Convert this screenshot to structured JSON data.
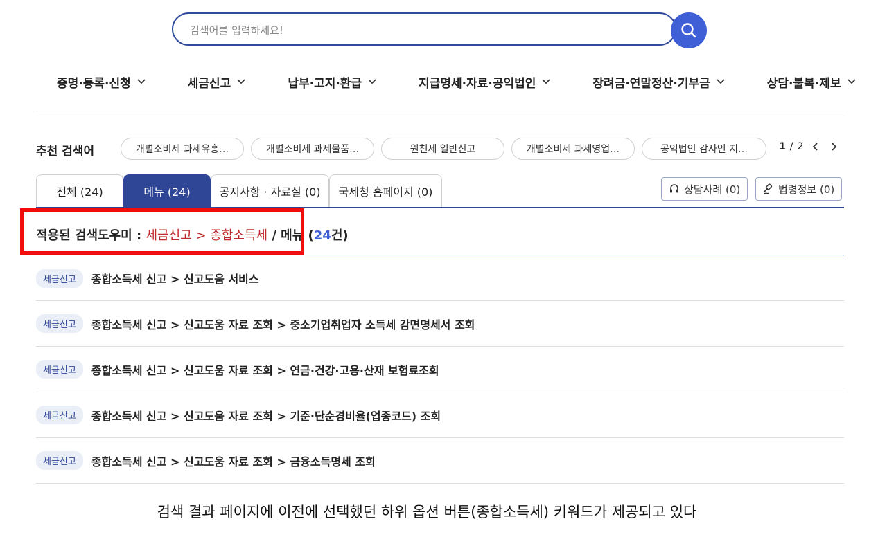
{
  "search": {
    "placeholder": "검색어를 입력하세요!"
  },
  "gnb": [
    {
      "label": "증명·등록·신청"
    },
    {
      "label": "세금신고"
    },
    {
      "label": "납부·고지·환급"
    },
    {
      "label": "지급명세·자료·공익법인"
    },
    {
      "label": "장려금·연말정산·기부금"
    },
    {
      "label": "상담·불복·제보"
    }
  ],
  "recommend": {
    "title": "추천 검색어",
    "chips": [
      {
        "label": "개별소비세 과세유흥…"
      },
      {
        "label": "개별소비세 과세물품…"
      },
      {
        "label": "원천세 일반신고"
      },
      {
        "label": "개별소비세 과세영업…"
      },
      {
        "label": "공익법인 감사인 지…"
      }
    ],
    "page_current": "1",
    "page_sep": "/",
    "page_total": "2"
  },
  "tabs": [
    {
      "label": "전체 (24)"
    },
    {
      "label": "메뉴 (24)"
    },
    {
      "label": "공지사항 · 자료실 (0)"
    },
    {
      "label": "국세청 홈페이지 (0)"
    }
  ],
  "side_buttons": {
    "consult": "상담사례 (0)",
    "law": "법령정보 (0)"
  },
  "applied": {
    "prefix": "적용된 검색도우미 : ",
    "path": "세금신고 > 종합소득세",
    "sep": " / ",
    "category": "메뉴 (",
    "count": "24",
    "suffix": "건)"
  },
  "results": [
    {
      "tag": "세금신고",
      "path": "종합소득세 신고 > 신고도움 서비스"
    },
    {
      "tag": "세금신고",
      "path": "종합소득세 신고 > 신고도움 자료 조회 > 중소기업취업자 소득세 감면명세서 조회"
    },
    {
      "tag": "세금신고",
      "path": "종합소득세 신고 > 신고도움 자료 조회 > 연금·건강·고용·산재 보험료조회"
    },
    {
      "tag": "세금신고",
      "path": "종합소득세 신고 > 신고도움 자료 조회 > 기준·단순경비율(업종코드) 조회"
    },
    {
      "tag": "세금신고",
      "path": "종합소득세 신고 > 신고도움 자료 조회 > 금융소득명세 조회"
    }
  ],
  "caption": "검색 결과 페이지에 이전에 선택했던 하위 옵션 버튼(종합소득세) 키워드가 제공되고 있다",
  "colors": {
    "primary": "#2f4596",
    "search_btn": "#3f5fd6",
    "highlight": "#f20d0d",
    "path_red": "#c0292b"
  },
  "icons": {
    "search": "search-icon",
    "chevron": "chevron-down-icon",
    "headset": "headset-icon",
    "gavel": "gavel-icon"
  }
}
